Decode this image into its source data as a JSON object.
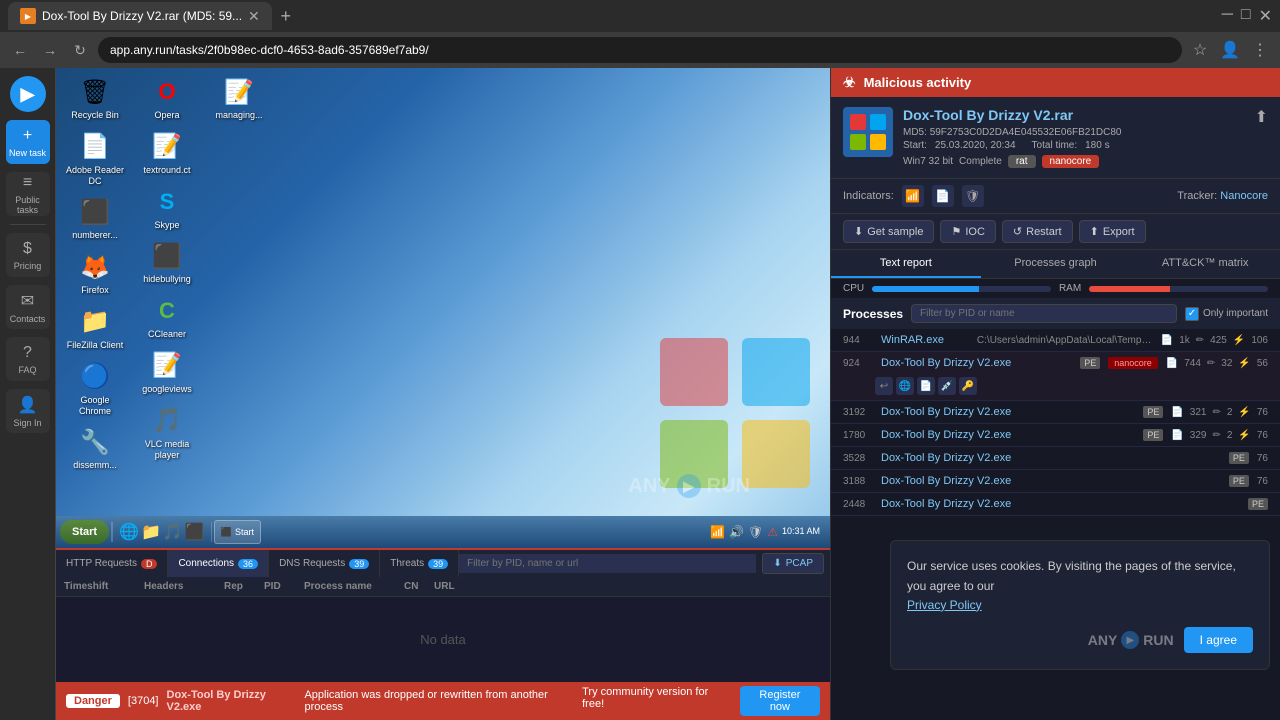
{
  "browser": {
    "tab_title": "Dox-Tool By Drizzy V2.rar (MD5: 59...",
    "url": "app.any.run/tasks/2f0b98ec-dcf0-4653-8ad6-357689ef7ab9/",
    "new_tab_label": "+"
  },
  "malicious_bar": {
    "label": "Malicious activity",
    "icon": "☣"
  },
  "file": {
    "name": "Dox-Tool By Drizzy V2.rar",
    "md5_label": "MD5:",
    "md5": "59F2753C0D2DA4E045532E06FB21DC80",
    "start_label": "Start:",
    "start": "25.03.2020, 20:34",
    "total_time_label": "Total time:",
    "total_time": "180 s",
    "os": "Win7 32 bit",
    "status": "Complete",
    "rat_badge": "rat",
    "nanocore_badge": "nanocore"
  },
  "indicators": {
    "label": "Indicators:",
    "tracker_label": "Tracker:",
    "tracker_name": "Nanocore"
  },
  "action_buttons": {
    "get_sample": "Get sample",
    "ioc": "IOC",
    "restart": "Restart",
    "export": "Export"
  },
  "view_tabs": {
    "text_report": "Text report",
    "processes_graph": "Processes graph",
    "att_matrix": "ATT&CK™ matrix"
  },
  "resource_bar": {
    "cpu_label": "CPU",
    "ram_label": "RAM",
    "cpu_percent": 60
  },
  "processes": {
    "label": "Processes",
    "search_placeholder": "Filter by PID or name",
    "only_important": "Only important",
    "items": [
      {
        "pid": "944",
        "name": "WinRAR.exe",
        "path": "C:\\Users\\admin\\AppData\\Local\\Temp\\Dox-Tool By Drizzy V...",
        "pe": true,
        "nanocore": false,
        "reads": "1k",
        "writes": "425",
        "files": "106"
      },
      {
        "pid": "924",
        "name": "Dox-Tool By Drizzy V2.exe",
        "path": "",
        "pe": true,
        "nanocore": true,
        "reads": "744",
        "writes": "32",
        "files": "56"
      },
      {
        "pid": "3192",
        "name": "Dox-Tool By Drizzy V2.exe",
        "path": "",
        "pe": true,
        "nanocore": false,
        "reads": "321",
        "writes": "2",
        "files": "76"
      },
      {
        "pid": "1780",
        "name": "Dox-Tool By Drizzy V2.exe",
        "path": "",
        "pe": true,
        "nanocore": false,
        "reads": "329",
        "writes": "2",
        "files": "76"
      },
      {
        "pid": "3528",
        "name": "Dox-Tool By Drizzy V2.exe",
        "path": "",
        "pe": true,
        "nanocore": false,
        "reads": "...",
        "writes": "...",
        "files": "76"
      },
      {
        "pid": "3188",
        "name": "Dox-Tool By Drizzy V2.exe",
        "path": "",
        "pe": true,
        "nanocore": false,
        "reads": "...",
        "writes": "...",
        "files": "76"
      },
      {
        "pid": "2448",
        "name": "Dox-Tool By Drizzy V2.exe",
        "path": "",
        "pe": true,
        "nanocore": false,
        "reads": "...",
        "writes": "...",
        "files": "..."
      }
    ]
  },
  "cookie": {
    "text": "Our service uses cookies. By visiting the pages of the service, you agree to our",
    "link_text": "Privacy Policy",
    "agree_label": "I agree"
  },
  "network": {
    "tabs": [
      {
        "label": "HTTP Requests",
        "count": "D",
        "count_type": "danger"
      },
      {
        "label": "Connections",
        "count": "36",
        "count_type": "normal"
      },
      {
        "label": "DNS Requests",
        "count": "39",
        "count_type": "normal"
      },
      {
        "label": "Threats",
        "count": "39",
        "count_type": "normal"
      }
    ],
    "filter_placeholder": "Filter by PID, name or url",
    "pcap_label": "PCAP",
    "table_headers": [
      "Timeshift",
      "Headers",
      "Rep",
      "PID",
      "Process name",
      "CN",
      "URL"
    ],
    "no_data": "No data"
  },
  "bottom_bar": {
    "danger_label": "Danger",
    "pid": "[3704]",
    "process_name": "Dox-Tool By Drizzy V2.exe",
    "message": "Application was dropped or rewritten from another process",
    "community_text": "Try community version for free!",
    "register_label": "Register now"
  },
  "sidebar": {
    "logo_text": "▶",
    "items": [
      {
        "label": "New task",
        "icon": "+"
      },
      {
        "label": "Public tasks",
        "icon": "≡"
      },
      {
        "label": "Pricing",
        "icon": "$"
      },
      {
        "label": "Contacts",
        "icon": "✉"
      },
      {
        "label": "FAQ",
        "icon": "?"
      },
      {
        "label": "Sign In",
        "icon": "👤"
      }
    ]
  },
  "desktop_icons": [
    {
      "label": "Recycle Bin",
      "icon": "🗑"
    },
    {
      "label": "Adobe Reader DC",
      "icon": "📄"
    },
    {
      "label": "numberer...",
      "icon": "⬛"
    },
    {
      "label": "Firefox",
      "icon": "🦊"
    },
    {
      "label": "FileZilla Client",
      "icon": "📁"
    },
    {
      "label": "Google Chrome",
      "icon": "🔵"
    },
    {
      "label": "dissemm...",
      "icon": "🔧"
    },
    {
      "label": "Opera",
      "icon": "O"
    },
    {
      "label": "textround.ct",
      "icon": "📝"
    },
    {
      "label": "Skype",
      "icon": "S"
    },
    {
      "label": "hidebullying",
      "icon": "⬛"
    },
    {
      "label": "CCleaner",
      "icon": "C"
    },
    {
      "label": "googleviews",
      "icon": "📝"
    },
    {
      "label": "VLC media player",
      "icon": "🎵"
    },
    {
      "label": "managing...",
      "icon": "📝"
    }
  ],
  "taskbar": {
    "start_label": "Start",
    "time": "10:31 AM",
    "apps": [
      {
        "label": "Start"
      }
    ]
  },
  "anyrun_watermark": "ANY ▶ RUN"
}
